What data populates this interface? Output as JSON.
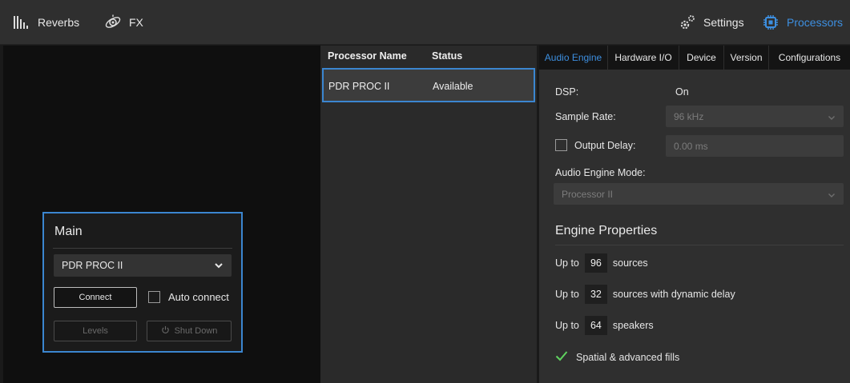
{
  "topbar": {
    "reverbs_label": "Reverbs",
    "fx_label": "FX",
    "settings_label": "Settings",
    "processors_label": "Processors",
    "accent_color": "#3d8fe0"
  },
  "main_card": {
    "title": "Main",
    "selected_processor": "PDR PROC II",
    "connect_label": "Connect",
    "auto_connect_label": "Auto connect",
    "auto_connect_checked": false,
    "levels_label": "Levels",
    "shutdown_label": "Shut Down"
  },
  "processor_table": {
    "headers": [
      "Processor Name",
      "Status"
    ],
    "rows": [
      {
        "name": "PDR PROC II",
        "status": "Available",
        "selected": true
      }
    ]
  },
  "tabs": [
    {
      "label": "Audio Engine",
      "active": true
    },
    {
      "label": "Hardware I/O",
      "active": false
    },
    {
      "label": "Device",
      "active": false
    },
    {
      "label": "Version",
      "active": false
    },
    {
      "label": "Configurations",
      "active": false
    }
  ],
  "audio_engine": {
    "dsp_label": "DSP:",
    "dsp_value": "On",
    "sample_rate_label": "Sample Rate:",
    "sample_rate_value": "96 kHz",
    "output_delay_label": "Output Delay:",
    "output_delay_checked": false,
    "output_delay_value": "0.00 ms",
    "mode_label": "Audio Engine Mode:",
    "mode_value": "Processor II"
  },
  "engine_properties": {
    "title": "Engine Properties",
    "rows": [
      {
        "prefix": "Up to",
        "value": "96",
        "suffix": "sources"
      },
      {
        "prefix": "Up to",
        "value": "32",
        "suffix": "sources with dynamic delay"
      },
      {
        "prefix": "Up to",
        "value": "64",
        "suffix": "speakers"
      }
    ],
    "feature": "Spatial & advanced fills",
    "feature_check_color": "#5fd35f"
  }
}
